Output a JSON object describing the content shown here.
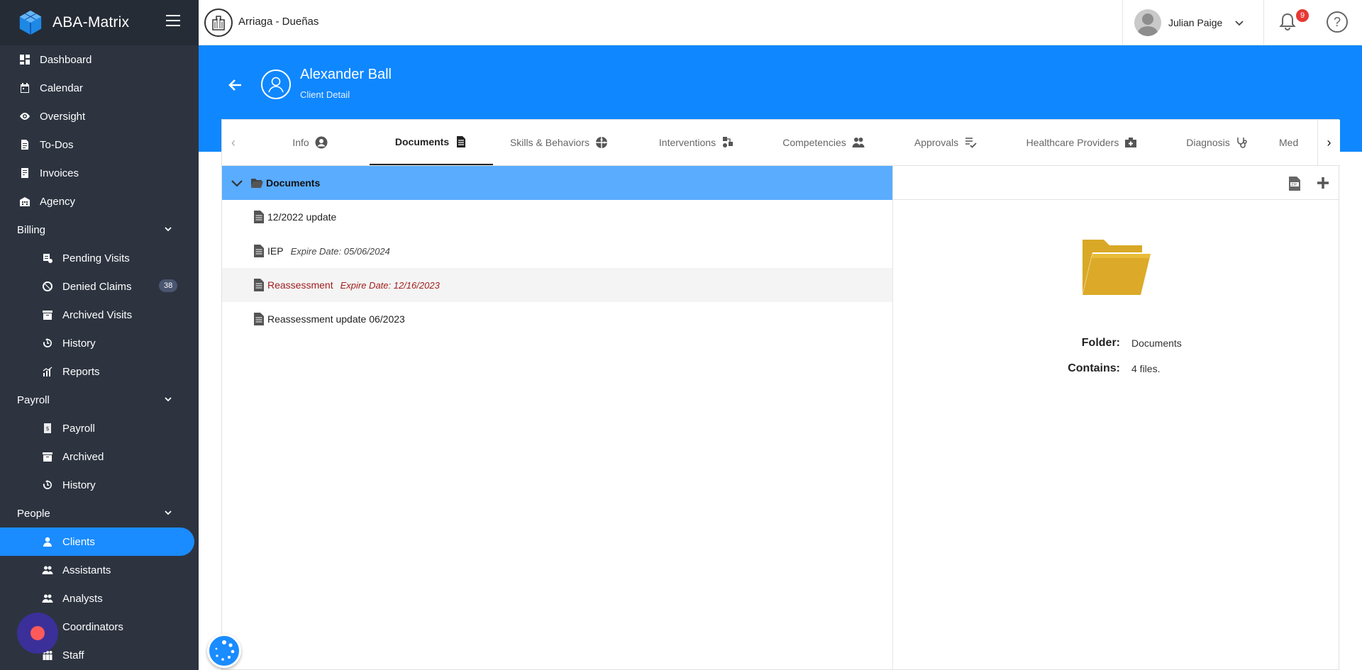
{
  "app": {
    "name": "ABA-Matrix"
  },
  "sidebar": {
    "top_items": [
      {
        "label": "Dashboard",
        "icon": "dashboard-icon"
      },
      {
        "label": "Calendar",
        "icon": "calendar-icon"
      },
      {
        "label": "Oversight",
        "icon": "eye-icon"
      },
      {
        "label": "To-Dos",
        "icon": "todo-icon"
      },
      {
        "label": "Invoices",
        "icon": "invoice-icon"
      },
      {
        "label": "Agency",
        "icon": "agency-icon"
      }
    ],
    "billing": {
      "title": "Billing",
      "items": [
        {
          "label": "Pending Visits"
        },
        {
          "label": "Denied Claims",
          "badge": "38"
        },
        {
          "label": "Archived Visits"
        },
        {
          "label": "History"
        },
        {
          "label": "Reports"
        }
      ]
    },
    "payroll": {
      "title": "Payroll",
      "items": [
        {
          "label": "Payroll"
        },
        {
          "label": "Archived"
        },
        {
          "label": "History"
        }
      ]
    },
    "people": {
      "title": "People",
      "items": [
        {
          "label": "Clients",
          "active": true
        },
        {
          "label": "Assistants"
        },
        {
          "label": "Analysts"
        },
        {
          "label": "Coordinators"
        },
        {
          "label": "Staff"
        }
      ]
    }
  },
  "topbar": {
    "org_name": "Arriaga - Dueñas",
    "user_name": "Julian Paige",
    "notification_count": "9"
  },
  "header": {
    "client_name": "Alexander Ball",
    "subtitle": "Client Detail"
  },
  "tabs": [
    {
      "label": "Info",
      "icon": "person-circle-icon"
    },
    {
      "label": "Documents",
      "icon": "document-icon",
      "active": true
    },
    {
      "label": "Skills & Behaviors",
      "icon": "puzzle-icon"
    },
    {
      "label": "Interventions",
      "icon": "interventions-icon"
    },
    {
      "label": "Competencies",
      "icon": "users-icon"
    },
    {
      "label": "Approvals",
      "icon": "approval-icon"
    },
    {
      "label": "Healthcare Providers",
      "icon": "medkit-icon"
    },
    {
      "label": "Diagnosis",
      "icon": "stethoscope-icon"
    },
    {
      "label": "Med"
    }
  ],
  "tree": {
    "root": "Documents",
    "files": [
      {
        "name": "12/2022 update",
        "expire": ""
      },
      {
        "name": "IEP",
        "expire": "Expire Date: 05/06/2024"
      },
      {
        "name": "Reassessment",
        "expire": "Expire Date: 12/16/2023",
        "highlight": true
      },
      {
        "name": "Reassessment update 06/2023",
        "expire": ""
      }
    ]
  },
  "details": {
    "folder_label": "Folder:",
    "folder_value": "Documents",
    "contains_label": "Contains:",
    "contains_value": "4 files."
  },
  "colors": {
    "accent": "#0f87ff",
    "sidebar_bg": "#2d3440",
    "tree_root_bg": "#5aacff",
    "folder": "#d9a826",
    "highlight_text": "#a02020"
  }
}
